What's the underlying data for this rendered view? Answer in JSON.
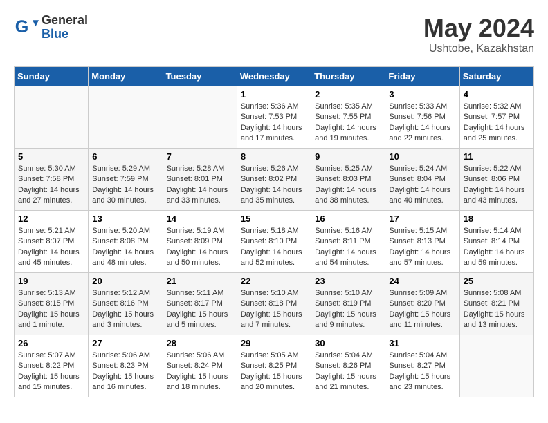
{
  "header": {
    "logo_general": "General",
    "logo_blue": "Blue",
    "month_title": "May 2024",
    "location": "Ushtobe, Kazakhstan"
  },
  "columns": [
    "Sunday",
    "Monday",
    "Tuesday",
    "Wednesday",
    "Thursday",
    "Friday",
    "Saturday"
  ],
  "weeks": [
    [
      {
        "day": "",
        "info": ""
      },
      {
        "day": "",
        "info": ""
      },
      {
        "day": "",
        "info": ""
      },
      {
        "day": "1",
        "info": "Sunrise: 5:36 AM\nSunset: 7:53 PM\nDaylight: 14 hours\nand 17 minutes."
      },
      {
        "day": "2",
        "info": "Sunrise: 5:35 AM\nSunset: 7:55 PM\nDaylight: 14 hours\nand 19 minutes."
      },
      {
        "day": "3",
        "info": "Sunrise: 5:33 AM\nSunset: 7:56 PM\nDaylight: 14 hours\nand 22 minutes."
      },
      {
        "day": "4",
        "info": "Sunrise: 5:32 AM\nSunset: 7:57 PM\nDaylight: 14 hours\nand 25 minutes."
      }
    ],
    [
      {
        "day": "5",
        "info": "Sunrise: 5:30 AM\nSunset: 7:58 PM\nDaylight: 14 hours\nand 27 minutes."
      },
      {
        "day": "6",
        "info": "Sunrise: 5:29 AM\nSunset: 7:59 PM\nDaylight: 14 hours\nand 30 minutes."
      },
      {
        "day": "7",
        "info": "Sunrise: 5:28 AM\nSunset: 8:01 PM\nDaylight: 14 hours\nand 33 minutes."
      },
      {
        "day": "8",
        "info": "Sunrise: 5:26 AM\nSunset: 8:02 PM\nDaylight: 14 hours\nand 35 minutes."
      },
      {
        "day": "9",
        "info": "Sunrise: 5:25 AM\nSunset: 8:03 PM\nDaylight: 14 hours\nand 38 minutes."
      },
      {
        "day": "10",
        "info": "Sunrise: 5:24 AM\nSunset: 8:04 PM\nDaylight: 14 hours\nand 40 minutes."
      },
      {
        "day": "11",
        "info": "Sunrise: 5:22 AM\nSunset: 8:06 PM\nDaylight: 14 hours\nand 43 minutes."
      }
    ],
    [
      {
        "day": "12",
        "info": "Sunrise: 5:21 AM\nSunset: 8:07 PM\nDaylight: 14 hours\nand 45 minutes."
      },
      {
        "day": "13",
        "info": "Sunrise: 5:20 AM\nSunset: 8:08 PM\nDaylight: 14 hours\nand 48 minutes."
      },
      {
        "day": "14",
        "info": "Sunrise: 5:19 AM\nSunset: 8:09 PM\nDaylight: 14 hours\nand 50 minutes."
      },
      {
        "day": "15",
        "info": "Sunrise: 5:18 AM\nSunset: 8:10 PM\nDaylight: 14 hours\nand 52 minutes."
      },
      {
        "day": "16",
        "info": "Sunrise: 5:16 AM\nSunset: 8:11 PM\nDaylight: 14 hours\nand 54 minutes."
      },
      {
        "day": "17",
        "info": "Sunrise: 5:15 AM\nSunset: 8:13 PM\nDaylight: 14 hours\nand 57 minutes."
      },
      {
        "day": "18",
        "info": "Sunrise: 5:14 AM\nSunset: 8:14 PM\nDaylight: 14 hours\nand 59 minutes."
      }
    ],
    [
      {
        "day": "19",
        "info": "Sunrise: 5:13 AM\nSunset: 8:15 PM\nDaylight: 15 hours\nand 1 minute."
      },
      {
        "day": "20",
        "info": "Sunrise: 5:12 AM\nSunset: 8:16 PM\nDaylight: 15 hours\nand 3 minutes."
      },
      {
        "day": "21",
        "info": "Sunrise: 5:11 AM\nSunset: 8:17 PM\nDaylight: 15 hours\nand 5 minutes."
      },
      {
        "day": "22",
        "info": "Sunrise: 5:10 AM\nSunset: 8:18 PM\nDaylight: 15 hours\nand 7 minutes."
      },
      {
        "day": "23",
        "info": "Sunrise: 5:10 AM\nSunset: 8:19 PM\nDaylight: 15 hours\nand 9 minutes."
      },
      {
        "day": "24",
        "info": "Sunrise: 5:09 AM\nSunset: 8:20 PM\nDaylight: 15 hours\nand 11 minutes."
      },
      {
        "day": "25",
        "info": "Sunrise: 5:08 AM\nSunset: 8:21 PM\nDaylight: 15 hours\nand 13 minutes."
      }
    ],
    [
      {
        "day": "26",
        "info": "Sunrise: 5:07 AM\nSunset: 8:22 PM\nDaylight: 15 hours\nand 15 minutes."
      },
      {
        "day": "27",
        "info": "Sunrise: 5:06 AM\nSunset: 8:23 PM\nDaylight: 15 hours\nand 16 minutes."
      },
      {
        "day": "28",
        "info": "Sunrise: 5:06 AM\nSunset: 8:24 PM\nDaylight: 15 hours\nand 18 minutes."
      },
      {
        "day": "29",
        "info": "Sunrise: 5:05 AM\nSunset: 8:25 PM\nDaylight: 15 hours\nand 20 minutes."
      },
      {
        "day": "30",
        "info": "Sunrise: 5:04 AM\nSunset: 8:26 PM\nDaylight: 15 hours\nand 21 minutes."
      },
      {
        "day": "31",
        "info": "Sunrise: 5:04 AM\nSunset: 8:27 PM\nDaylight: 15 hours\nand 23 minutes."
      },
      {
        "day": "",
        "info": ""
      }
    ]
  ]
}
